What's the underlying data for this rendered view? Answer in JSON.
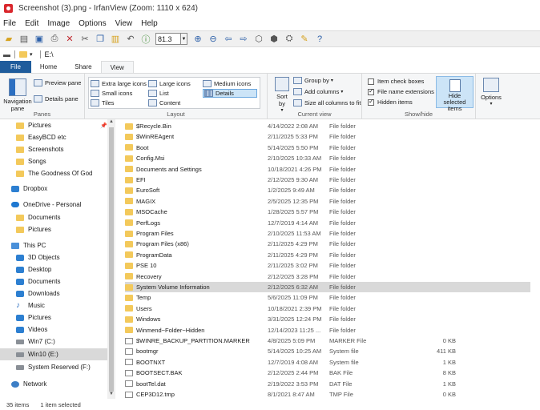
{
  "irfanview": {
    "title": "Screenshot (3).png - IrfanView (Zoom: 1110 x 624)",
    "menu": [
      "File",
      "Edit",
      "Image",
      "Options",
      "View",
      "Help"
    ],
    "zoom_value": "81.3",
    "toolbar_icons": [
      "open-folder-icon",
      "slideshow-icon",
      "save-icon",
      "print-icon",
      "delete-icon",
      "cut-icon",
      "copy-icon",
      "paste-icon",
      "undo-icon",
      "info-icon",
      "zoom-in-icon",
      "zoom-out-icon",
      "previous-icon",
      "next-icon",
      "first-icon",
      "last-icon",
      "batch-icon",
      "paint-icon",
      "help-icon"
    ]
  },
  "explorer": {
    "path_label": "E:\\",
    "tabs": [
      "File",
      "Home",
      "Share",
      "View"
    ],
    "ribbon": {
      "panes": {
        "label": "Panes",
        "navigation_pane": "Navigation pane",
        "preview_pane": "Preview pane",
        "details_pane": "Details pane"
      },
      "layout": {
        "label": "Layout",
        "items": [
          "Extra large icons",
          "Large icons",
          "Medium icons",
          "Small icons",
          "List",
          "Details",
          "Tiles",
          "Content"
        ],
        "selected": "Details"
      },
      "current_view": {
        "label": "Current view",
        "sort_by": "Sort by",
        "group_by": "Group by",
        "add_columns": "Add columns",
        "size_all_columns": "Size all columns to fit"
      },
      "show_hide": {
        "label": "Show/hide",
        "item_check_boxes": "Item check boxes",
        "file_name_extensions": "File name extensions",
        "hidden_items": "Hidden items",
        "hide_selected_items": "Hide selected items"
      },
      "options": "Options"
    },
    "nav": [
      {
        "label": "Pictures",
        "icon": "folder",
        "indent": 1,
        "pinned": true
      },
      {
        "label": "EasyBCD etc",
        "icon": "folder",
        "indent": 1
      },
      {
        "label": "Screenshots",
        "icon": "folder",
        "indent": 1
      },
      {
        "label": "Songs",
        "icon": "folder",
        "indent": 1
      },
      {
        "label": "The Goodness Of God",
        "icon": "folder",
        "indent": 1
      },
      {
        "label": "Dropbox",
        "icon": "dropbox",
        "indent": 0
      },
      {
        "label": "OneDrive - Personal",
        "icon": "cloud",
        "indent": 0
      },
      {
        "label": "Documents",
        "icon": "folder",
        "indent": 1
      },
      {
        "label": "Pictures",
        "icon": "folder",
        "indent": 1
      },
      {
        "label": "This PC",
        "icon": "pc",
        "indent": 0
      },
      {
        "label": "3D Objects",
        "icon": "blue",
        "indent": 1
      },
      {
        "label": "Desktop",
        "icon": "blue",
        "indent": 1
      },
      {
        "label": "Documents",
        "icon": "blue",
        "indent": 1
      },
      {
        "label": "Downloads",
        "icon": "blue",
        "indent": 1
      },
      {
        "label": "Music",
        "icon": "music",
        "indent": 1
      },
      {
        "label": "Pictures",
        "icon": "blue",
        "indent": 1
      },
      {
        "label": "Videos",
        "icon": "blue",
        "indent": 1
      },
      {
        "label": "Win7 (C:)",
        "icon": "drive",
        "indent": 1
      },
      {
        "label": "Win10 (E:)",
        "icon": "drive",
        "indent": 1,
        "selected": true
      },
      {
        "label": "System Reserved (F:)",
        "icon": "drive",
        "indent": 1
      },
      {
        "label": "Network",
        "icon": "net",
        "indent": 0
      }
    ],
    "files": [
      {
        "name": "$Recycle.Bin",
        "date": "4/14/2022 2:08 AM",
        "type": "File folder",
        "size": "",
        "icon": "folder"
      },
      {
        "name": "$WinREAgent",
        "date": "2/11/2025 5:33 PM",
        "type": "File folder",
        "size": "",
        "icon": "folder"
      },
      {
        "name": "Boot",
        "date": "5/14/2025 5:50 PM",
        "type": "File folder",
        "size": "",
        "icon": "folder"
      },
      {
        "name": "Config.Msi",
        "date": "2/10/2025 10:33 AM",
        "type": "File folder",
        "size": "",
        "icon": "folder"
      },
      {
        "name": "Documents and Settings",
        "date": "10/18/2021 4:26 PM",
        "type": "File folder",
        "size": "",
        "icon": "link"
      },
      {
        "name": "EFI",
        "date": "2/12/2025 9:30 AM",
        "type": "File folder",
        "size": "",
        "icon": "folder"
      },
      {
        "name": "EuroSoft",
        "date": "1/2/2025 9:49 AM",
        "type": "File folder",
        "size": "",
        "icon": "folder"
      },
      {
        "name": "MAGIX",
        "date": "2/5/2025 12:35 PM",
        "type": "File folder",
        "size": "",
        "icon": "folder"
      },
      {
        "name": "MSOCache",
        "date": "1/28/2025 5:57 PM",
        "type": "File folder",
        "size": "",
        "icon": "folder"
      },
      {
        "name": "PerfLogs",
        "date": "12/7/2019 4:14 AM",
        "type": "File folder",
        "size": "",
        "icon": "folder"
      },
      {
        "name": "Program Files",
        "date": "2/10/2025 11:53 AM",
        "type": "File folder",
        "size": "",
        "icon": "folder"
      },
      {
        "name": "Program Files (x86)",
        "date": "2/11/2025 4:29 PM",
        "type": "File folder",
        "size": "",
        "icon": "folder"
      },
      {
        "name": "ProgramData",
        "date": "2/11/2025 4:29 PM",
        "type": "File folder",
        "size": "",
        "icon": "folder"
      },
      {
        "name": "PSE 10",
        "date": "2/11/2025 3:02 PM",
        "type": "File folder",
        "size": "",
        "icon": "folder"
      },
      {
        "name": "Recovery",
        "date": "2/12/2025 3:28 PM",
        "type": "File folder",
        "size": "",
        "icon": "folder"
      },
      {
        "name": "System Volume Information",
        "date": "2/12/2025 6:32 AM",
        "type": "File folder",
        "size": "",
        "icon": "folder",
        "selected": true
      },
      {
        "name": "Temp",
        "date": "5/6/2025 11:09 PM",
        "type": "File folder",
        "size": "",
        "icon": "folder"
      },
      {
        "name": "Users",
        "date": "10/18/2021 2:39 PM",
        "type": "File folder",
        "size": "",
        "icon": "folder"
      },
      {
        "name": "Windows",
        "date": "3/31/2025 12:24 PM",
        "type": "File folder",
        "size": "",
        "icon": "folder"
      },
      {
        "name": "Winmend~Folder~Hidden",
        "date": "12/14/2023 11:25 ...",
        "type": "File folder",
        "size": "",
        "icon": "folder"
      },
      {
        "name": "$WINRE_BACKUP_PARTITION.MARKER",
        "date": "4/8/2025 5:09 PM",
        "type": "MARKER File",
        "size": "0 KB",
        "icon": "file"
      },
      {
        "name": "bootmgr",
        "date": "5/14/2025 10:25 AM",
        "type": "System file",
        "size": "411 KB",
        "icon": "file"
      },
      {
        "name": "BOOTNXT",
        "date": "12/7/2019 4:08 AM",
        "type": "System file",
        "size": "1 KB",
        "icon": "file"
      },
      {
        "name": "BOOTSECT.BAK",
        "date": "2/12/2025 2:44 PM",
        "type": "BAK File",
        "size": "8 KB",
        "icon": "file"
      },
      {
        "name": "bootTel.dat",
        "date": "2/19/2022 3:53 PM",
        "type": "DAT File",
        "size": "1 KB",
        "icon": "file"
      },
      {
        "name": "CEP3D12.tmp",
        "date": "8/1/2021 8:47 AM",
        "type": "TMP File",
        "size": "0 KB",
        "icon": "file"
      }
    ],
    "status": {
      "items": "35 items",
      "selected": "1 item selected"
    }
  }
}
